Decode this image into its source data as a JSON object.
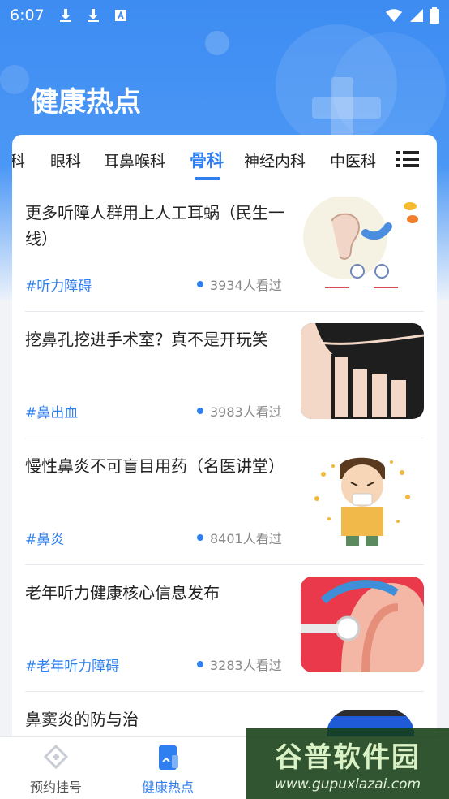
{
  "status_bar": {
    "time": "6:07",
    "left_icons": [
      "download-icon",
      "download-icon",
      "font-icon"
    ],
    "right_icons": [
      "wifi-icon",
      "signal-icon",
      "battery-icon"
    ]
  },
  "page_title": "健康热点",
  "tabs": [
    {
      "label": "科",
      "active": false
    },
    {
      "label": "眼科",
      "active": false
    },
    {
      "label": "耳鼻喉科",
      "active": false
    },
    {
      "label": "骨科",
      "active": true
    },
    {
      "label": "神经内科",
      "active": false
    },
    {
      "label": "中医科",
      "active": false
    }
  ],
  "articles": [
    {
      "title": "更多听障人群用上人工耳蜗（民生一线）",
      "tag": "#听力障碍",
      "views": "3934人看过",
      "thumb": "ear-cochlear-illustration"
    },
    {
      "title": "挖鼻孔挖进手术室？真不是开玩笑",
      "tag": "#鼻出血",
      "views": "3983人看过",
      "thumb": "nose-picking-illustration"
    },
    {
      "title": "慢性鼻炎不可盲目用药（名医讲堂）",
      "tag": "#鼻炎",
      "views": "8401人看过",
      "thumb": "sneezing-boy-illustration"
    },
    {
      "title": "老年听力健康核心信息发布",
      "tag": "#老年听力障碍",
      "views": "3283人看过",
      "thumb": "ear-hearing-aid-illustration"
    },
    {
      "title": "鼻窦炎的防与治",
      "tag": "",
      "views": "",
      "thumb": "blue-illustration"
    }
  ],
  "bottom_nav": [
    {
      "label": "预约挂号",
      "active": false,
      "icon": "hospital-cross-icon"
    },
    {
      "label": "健康热点",
      "active": true,
      "icon": "document-icon"
    }
  ],
  "watermark": {
    "main": "谷普软件园",
    "sub": "www.gupuxlazai.com"
  },
  "colors": {
    "accent": "#2f7ff0",
    "header": "#3d8cf2"
  }
}
